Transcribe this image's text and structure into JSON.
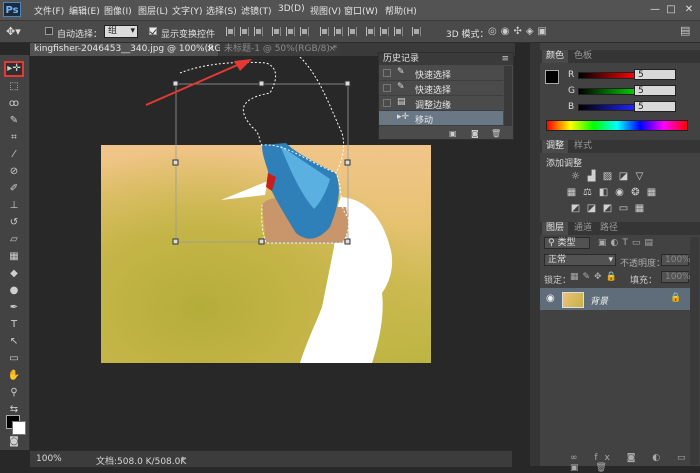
{
  "app": {
    "logo": "Ps"
  },
  "menu": [
    "文件(F)",
    "编辑(E)",
    "图像(I)",
    "图层(L)",
    "文字(Y)",
    "选择(S)",
    "滤镜(T)",
    "3D(D)",
    "视图(V)",
    "窗口(W)",
    "帮助(H)"
  ],
  "window_controls": {
    "minimize": "—",
    "maximize": "□",
    "close": "✕"
  },
  "options": {
    "auto_select_label": "自动选择：",
    "auto_select_value": "组",
    "show_transform_label": "显示变换控件",
    "mode_3d_label": "3D 模式："
  },
  "tabs": [
    {
      "label": "kingfisher-2046453__340.jpg @ 100%(RGB/8#) *",
      "close": "×"
    },
    {
      "label": "未标题-1 @ 50%(RGB/8) *",
      "close": "×"
    }
  ],
  "history": {
    "title": "历史记录",
    "items": [
      "快速选择",
      "快速选择",
      "调整边缘",
      "移动"
    ],
    "selected_index": 3
  },
  "color_panel": {
    "tabs": [
      "颜色",
      "色板"
    ],
    "channels": [
      {
        "label": "R",
        "value": "5",
        "color": "#d02020"
      },
      {
        "label": "G",
        "value": "5",
        "color": "#20a020"
      },
      {
        "label": "B",
        "value": "5",
        "color": "#2040d0"
      }
    ]
  },
  "adjust_panel": {
    "tabs": [
      "调整",
      "样式"
    ],
    "title": "添加调整"
  },
  "layers_panel": {
    "tabs": [
      "图层",
      "通道",
      "路径"
    ],
    "filter_label": "类型",
    "blend_mode": "正常",
    "opacity_label": "不透明度：",
    "opacity_value": "100%",
    "lock_label": "锁定：",
    "fill_label": "填充：",
    "fill_value": "100%",
    "layer_name": "背景"
  },
  "status": {
    "zoom": "100%",
    "doc_info": "文档:508.0 K/508.0K"
  }
}
